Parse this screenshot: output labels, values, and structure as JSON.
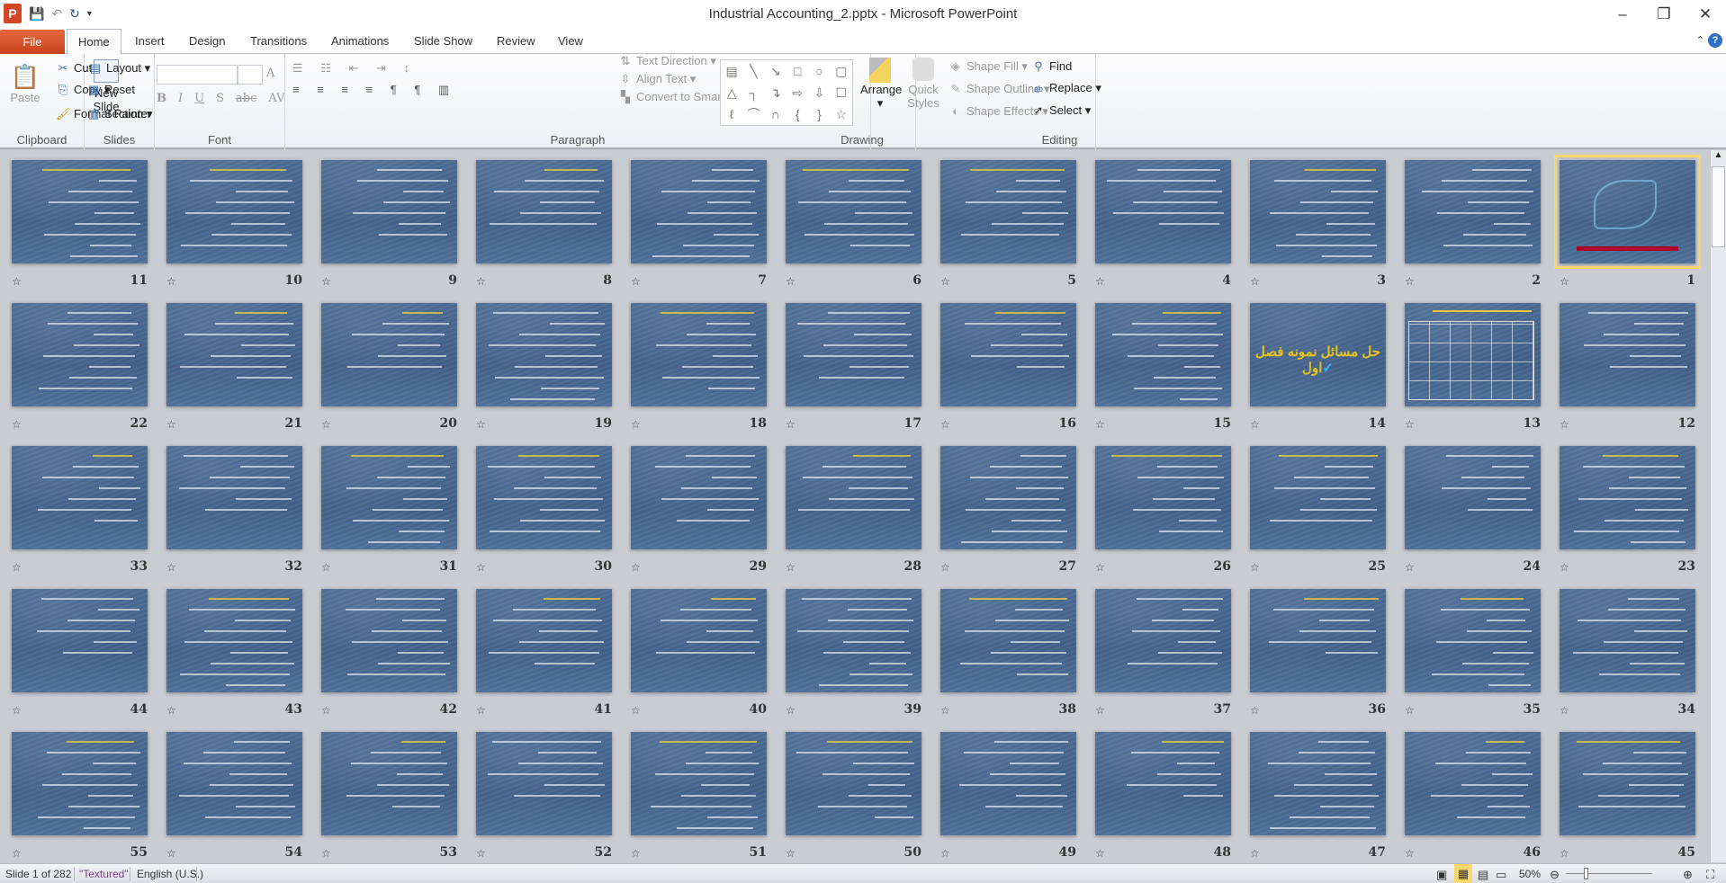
{
  "window": {
    "title": "Industrial Accounting_2.pptx - Microsoft PowerPoint",
    "app_icon": "P",
    "minimize": "–",
    "restore": "❐",
    "close": "✕"
  },
  "tabs": [
    "File",
    "Home",
    "Insert",
    "Design",
    "Transitions",
    "Animations",
    "Slide Show",
    "Review",
    "View"
  ],
  "active_tab": "Home",
  "ribbon": {
    "clipboard": {
      "label": "Clipboard",
      "paste": "Paste",
      "cut": "Cut",
      "copy": "Copy",
      "format_painter": "Format Painter"
    },
    "slides": {
      "label": "Slides",
      "new_slide": "New Slide",
      "layout": "Layout",
      "reset": "Reset",
      "section": "Section"
    },
    "font": {
      "label": "Font",
      "font_name": "",
      "font_size": "",
      "bold": "B",
      "italic": "I",
      "underline": "U",
      "shadow": "S",
      "strike": "abc",
      "spacing": "AV",
      "case": "Aa",
      "color": "A",
      "grow": "A",
      "shrink": "A"
    },
    "paragraph": {
      "label": "Paragraph",
      "text_direction": "Text Direction",
      "align_text": "Align Text",
      "convert_smartart": "Convert to SmartArt"
    },
    "drawing": {
      "label": "Drawing",
      "arrange": "Arrange",
      "quick_styles": "Quick Styles",
      "shape_fill": "Shape Fill",
      "shape_outline": "Shape Outline",
      "shape_effects": "Shape Effects"
    },
    "editing": {
      "label": "Editing",
      "find": "Find",
      "replace": "Replace",
      "select": "Select"
    }
  },
  "slides": {
    "selected": 1,
    "slide14_title": "حل مسائل نمونه فصل اول",
    "slide14_check": "✓",
    "numbers": [
      "1",
      "2",
      "3",
      "4",
      "5",
      "6",
      "7",
      "8",
      "9",
      "10",
      "11",
      "12",
      "13",
      "14",
      "15",
      "16",
      "17",
      "18",
      "19",
      "20",
      "21",
      "22",
      "23",
      "24",
      "25",
      "26",
      "27",
      "28",
      "29",
      "30",
      "31",
      "32",
      "33",
      "34",
      "35",
      "36",
      "37",
      "38",
      "39",
      "40",
      "41",
      "42",
      "43",
      "44",
      "45",
      "46",
      "47",
      "48",
      "49",
      "50",
      "51",
      "52",
      "53",
      "54",
      "55"
    ],
    "transition_icon": "animation-star-icon"
  },
  "status": {
    "slide": "Slide 1 of 282",
    "theme": "\"Textured\"",
    "language": "English (U.S.)",
    "zoom": "50%"
  },
  "colors": {
    "slide_bg": "#46678f",
    "selection": "#f6d66a",
    "file_tab": "#d24726"
  }
}
